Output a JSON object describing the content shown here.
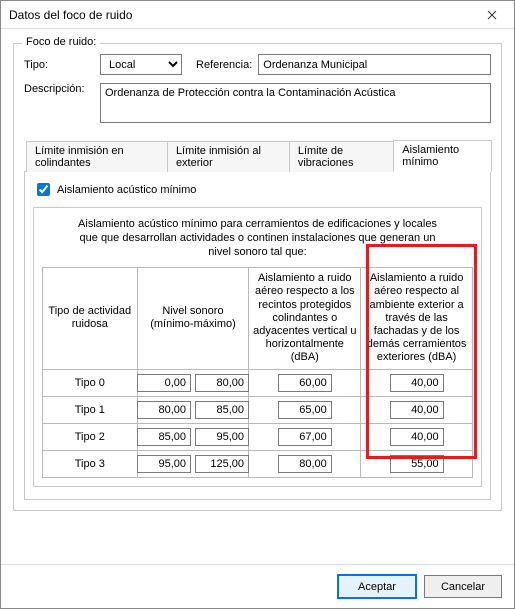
{
  "window": {
    "title": "Datos del foco de ruido"
  },
  "group": {
    "legend": "Foco de ruido:"
  },
  "form": {
    "tipo_label": "Tipo:",
    "tipo_value": "Local",
    "ref_label": "Referencia:",
    "ref_value": "Ordenanza Municipal",
    "desc_label": "Descripción:",
    "desc_value": "Ordenanza de Protección contra la Contaminación Acústica "
  },
  "tabs": {
    "t1": "Límite inmisión en colindantes",
    "t2": "Límite inmisión al exterior",
    "t3": "Límite de vibraciones",
    "t4": "Aislamiento mínimo"
  },
  "checkbox": {
    "label": "Aislamiento acústico mínimo"
  },
  "table": {
    "caption": "Aislamiento acústico mínimo para cerramientos de edificaciones y locales que que desarrollan actividades o continen instalaciones que generan un nivel sonoro tal que:",
    "headers": {
      "h1": "Tipo de actividad ruidosa",
      "h2": "Nivel sonoro (mínimo-máximo)",
      "h3": "Aislamiento a ruido aéreo respecto a los recintos protegidos colindantes o adyacentes vertical u horizontalmente (dBA)",
      "h4": "Aislamiento a ruido aéreo respecto al ambiente exterior a través de las fachadas y de los demás cerramientos exteriores (dBA)"
    },
    "rows": [
      {
        "tipo": "Tipo 0",
        "min": "0,00",
        "max": "80,00",
        "col3": "60,00",
        "col4": "40,00"
      },
      {
        "tipo": "Tipo 1",
        "min": "80,00",
        "max": "85,00",
        "col3": "65,00",
        "col4": "40,00"
      },
      {
        "tipo": "Tipo 2",
        "min": "85,00",
        "max": "95,00",
        "col3": "67,00",
        "col4": "40,00"
      },
      {
        "tipo": "Tipo 3",
        "min": "95,00",
        "max": "125,00",
        "col3": "80,00",
        "col4": "55,00"
      }
    ]
  },
  "buttons": {
    "ok": "Aceptar",
    "cancel": "Cancelar"
  }
}
